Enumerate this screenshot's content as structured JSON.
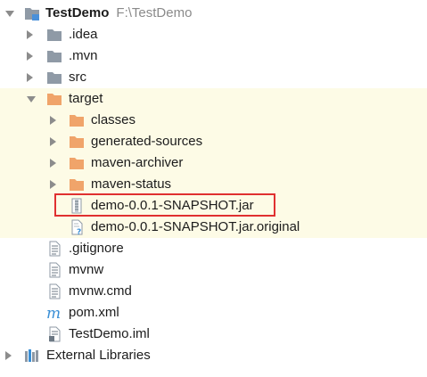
{
  "project": {
    "name": "TestDemo",
    "path": "F:\\TestDemo"
  },
  "tree": {
    "idea": ".idea",
    "mvn": ".mvn",
    "src": "src",
    "target": "target",
    "classes": "classes",
    "generated_sources": "generated-sources",
    "maven_archiver": "maven-archiver",
    "maven_status": "maven-status",
    "jar": "demo-0.0.1-SNAPSHOT.jar",
    "jar_original": "demo-0.0.1-SNAPSHOT.jar.original",
    "gitignore": ".gitignore",
    "mvnw": "mvnw",
    "mvnw_cmd": "mvnw.cmd",
    "pom": "pom.xml",
    "iml": "TestDemo.iml",
    "external_libraries": "External Libraries"
  },
  "colors": {
    "folder_gray": "#8f9aa6",
    "folder_orange": "#f0a46a",
    "highlight": "#fdfbe6",
    "selection_box": "#e03030",
    "maven_icon": "#3a8fd6"
  }
}
